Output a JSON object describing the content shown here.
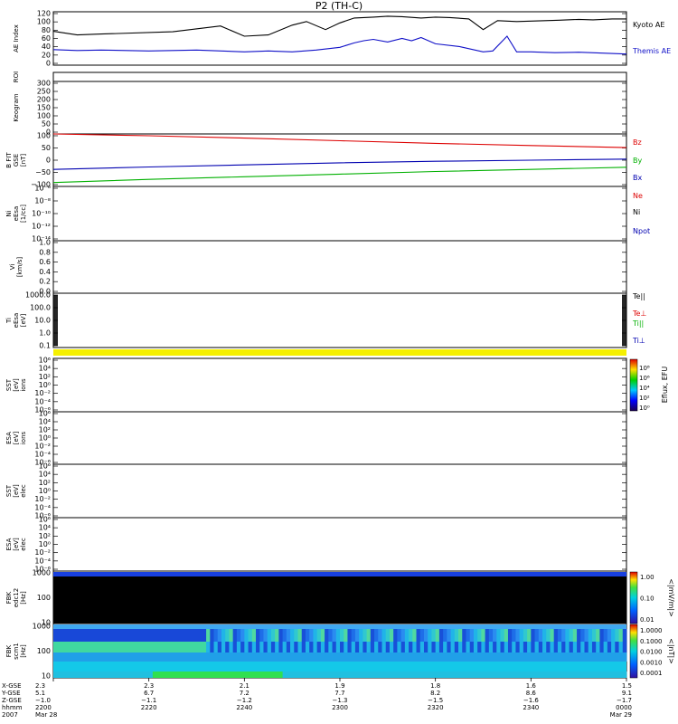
{
  "title": "P2 (TH-C)",
  "chart_data": {
    "type": "line",
    "title": "P2 (TH-C)",
    "panels": [
      {
        "id": "ae",
        "ylabel": [
          "AE Index"
        ],
        "ylim": [
          0,
          120
        ],
        "yticks": [
          "120",
          "100",
          "80",
          "60",
          "40",
          "20",
          "0"
        ],
        "series": [
          {
            "name": "Kyoto AE",
            "color": "#000000",
            "x": [
              0,
              5,
              10,
              25,
              35,
              40,
              45,
              50,
              53,
              57,
              60,
              63,
              67,
              70,
              73,
              77,
              80,
              83,
              87,
              90,
              93,
              97,
              100,
              103,
              106,
              110,
              113,
              117,
              120
            ],
            "y": [
              76,
              68,
              70,
              75,
              88,
              65,
              68,
              90,
              98,
              80,
              95,
              106,
              108,
              110,
              109,
              106,
              108,
              107,
              104,
              80,
              100,
              98,
              99,
              100,
              101,
              103,
              102,
              104,
              104
            ]
          },
          {
            "name": "Themis AE",
            "color": "#1010c8",
            "x": [
              0,
              5,
              10,
              20,
              30,
              40,
              45,
              50,
              55,
              60,
              63,
              65,
              67,
              70,
              73,
              75,
              77,
              80,
              85,
              90,
              92,
              95,
              97,
              100,
              105,
              110,
              115,
              120
            ],
            "y": [
              35,
              33,
              34,
              32,
              34,
              30,
              32,
              30,
              34,
              40,
              50,
              55,
              58,
              52,
              60,
              55,
              62,
              48,
              42,
              30,
              32,
              65,
              30,
              30,
              28,
              29,
              27,
              25
            ]
          }
        ]
      },
      {
        "id": "roi",
        "ylabel": [
          "ROI"
        ]
      },
      {
        "id": "keogram",
        "ylabel": [
          "Keogram"
        ],
        "ylim": [
          0,
          300
        ],
        "yticks": [
          "300",
          "250",
          "200",
          "150",
          "100",
          "50",
          "0"
        ]
      },
      {
        "id": "bfit",
        "ylabel": [
          "B FIT",
          "GSE",
          "[nT]"
        ],
        "ylim": [
          -100,
          100
        ],
        "yticks": [
          "100",
          "50",
          "0",
          "−50",
          "−100"
        ],
        "series": [
          {
            "name": "Bz",
            "color": "#dd0000",
            "x": [
              0,
              20,
              40,
              60,
              80,
              100,
              120
            ],
            "y": [
              100,
              93,
              84,
              74,
              64,
              56,
              48
            ]
          },
          {
            "name": "By",
            "color": "#00b000",
            "x": [
              0,
              20,
              40,
              60,
              80,
              100,
              120
            ],
            "y": [
              -85,
              -73,
              -63,
              -53,
              -43,
              -35,
              -27
            ]
          },
          {
            "name": "Bx",
            "color": "#0000b0",
            "x": [
              0,
              20,
              40,
              60,
              80,
              100,
              120
            ],
            "y": [
              -35,
              -26,
              -18,
              -10,
              -4,
              0,
              4
            ]
          }
        ]
      },
      {
        "id": "ni",
        "ylabel": [
          "Ni",
          "eEsa",
          "[1/cc]"
        ],
        "yticks": [
          "10⁻⁶",
          "10⁻⁸",
          "10⁻¹⁰",
          "10⁻¹²",
          "10⁻¹⁴"
        ],
        "series": [
          {
            "name": "Ne",
            "color": "#dd0000"
          },
          {
            "name": "Ni",
            "color": "#000000"
          },
          {
            "name": "Npot",
            "color": "#0000b0"
          }
        ]
      },
      {
        "id": "vi",
        "ylabel": [
          "Vi",
          "[km/s]"
        ],
        "ylim": [
          0,
          1
        ],
        "yticks": [
          "1.0",
          "0.8",
          "0.6",
          "0.4",
          "0.2",
          "0.0"
        ]
      },
      {
        "id": "ti",
        "ylabel": [
          "Ti",
          "eEsa",
          "[eV]"
        ],
        "yticks": [
          "1000.0",
          "100.0",
          "10.0",
          "1.0",
          "0.1"
        ],
        "series": [
          {
            "name": "Te||",
            "color": "#000000"
          },
          {
            "name": "Te⊥",
            "color": "#dd0000"
          },
          {
            "name": "Ti||",
            "color": "#00b000"
          },
          {
            "name": "Ti⊥",
            "color": "#0000b0"
          }
        ]
      },
      {
        "id": "sst1",
        "ylabel": [
          "SST",
          "[eV]",
          "ions"
        ],
        "yticks": [
          "10⁶",
          "10⁴",
          "10²",
          "10⁰",
          "10⁻²",
          "10⁻⁴",
          "10⁻⁶"
        ]
      },
      {
        "id": "esa1",
        "ylabel": [
          "ESA",
          "[eV]",
          "ions"
        ],
        "yticks": [
          "10⁶",
          "10⁴",
          "10²",
          "10⁰",
          "10⁻²",
          "10⁻⁴",
          "10⁻⁶"
        ]
      },
      {
        "id": "sst2",
        "ylabel": [
          "SST",
          "[eV]",
          "elec"
        ],
        "yticks": [
          "10⁶",
          "10⁴",
          "10²",
          "10⁰",
          "10⁻²",
          "10⁻⁴",
          "10⁻⁶"
        ]
      },
      {
        "id": "esa2",
        "ylabel": [
          "ESA",
          "[eV]",
          "elec"
        ],
        "yticks": [
          "10⁶",
          "10⁴",
          "10²",
          "10⁰",
          "10⁻²",
          "10⁻⁴",
          "10⁻⁶"
        ]
      },
      {
        "id": "fbk1",
        "ylabel": [
          "FBK",
          "edc12",
          "[Hz]"
        ],
        "yticks": [
          "1000",
          "100",
          "10"
        ],
        "colorbar": {
          "label": "<|mV/m|>",
          "ticks": [
            "1.00",
            "0.10",
            "0.01"
          ]
        }
      },
      {
        "id": "fbk2",
        "ylabel": [
          "FBK",
          "scm1",
          "[Hz]"
        ],
        "yticks": [
          "1000",
          "100",
          "10"
        ],
        "colorbar": {
          "label": "<|nT|>",
          "ticks": [
            "1.0000",
            "0.1000",
            "0.0100",
            "0.0010",
            "0.0001"
          ]
        }
      }
    ],
    "eflux_colorbar": {
      "label": "Eflux, EFU",
      "ticks": [
        "10⁸",
        "10⁶",
        "10⁴",
        "10²",
        "10⁰"
      ]
    },
    "x_axis": {
      "xlim": [
        0,
        120
      ],
      "row_labels": [
        "X-GSE",
        "Y-GSE",
        "Z-GSE",
        "hhmm",
        "2007"
      ],
      "ticks": [
        {
          "x": 0,
          "lines": [
            "2.3",
            "5.1",
            "−1.0",
            "2200",
            "Mar 28"
          ]
        },
        {
          "x": 20,
          "lines": [
            "2.3",
            "6.7",
            "−1.1",
            "2220",
            ""
          ]
        },
        {
          "x": 40,
          "lines": [
            "2.1",
            "7.2",
            "−1.2",
            "2240",
            ""
          ]
        },
        {
          "x": 60,
          "lines": [
            "1.9",
            "7.7",
            "−1.3",
            "2300",
            ""
          ]
        },
        {
          "x": 80,
          "lines": [
            "1.8",
            "8.2",
            "−1.5",
            "2320",
            ""
          ]
        },
        {
          "x": 100,
          "lines": [
            "1.6",
            "8.6",
            "−1.6",
            "2340",
            ""
          ]
        },
        {
          "x": 120,
          "lines": [
            "1.5",
            "9.1",
            "−1.7",
            "0000",
            "Mar 29"
          ]
        }
      ]
    }
  }
}
